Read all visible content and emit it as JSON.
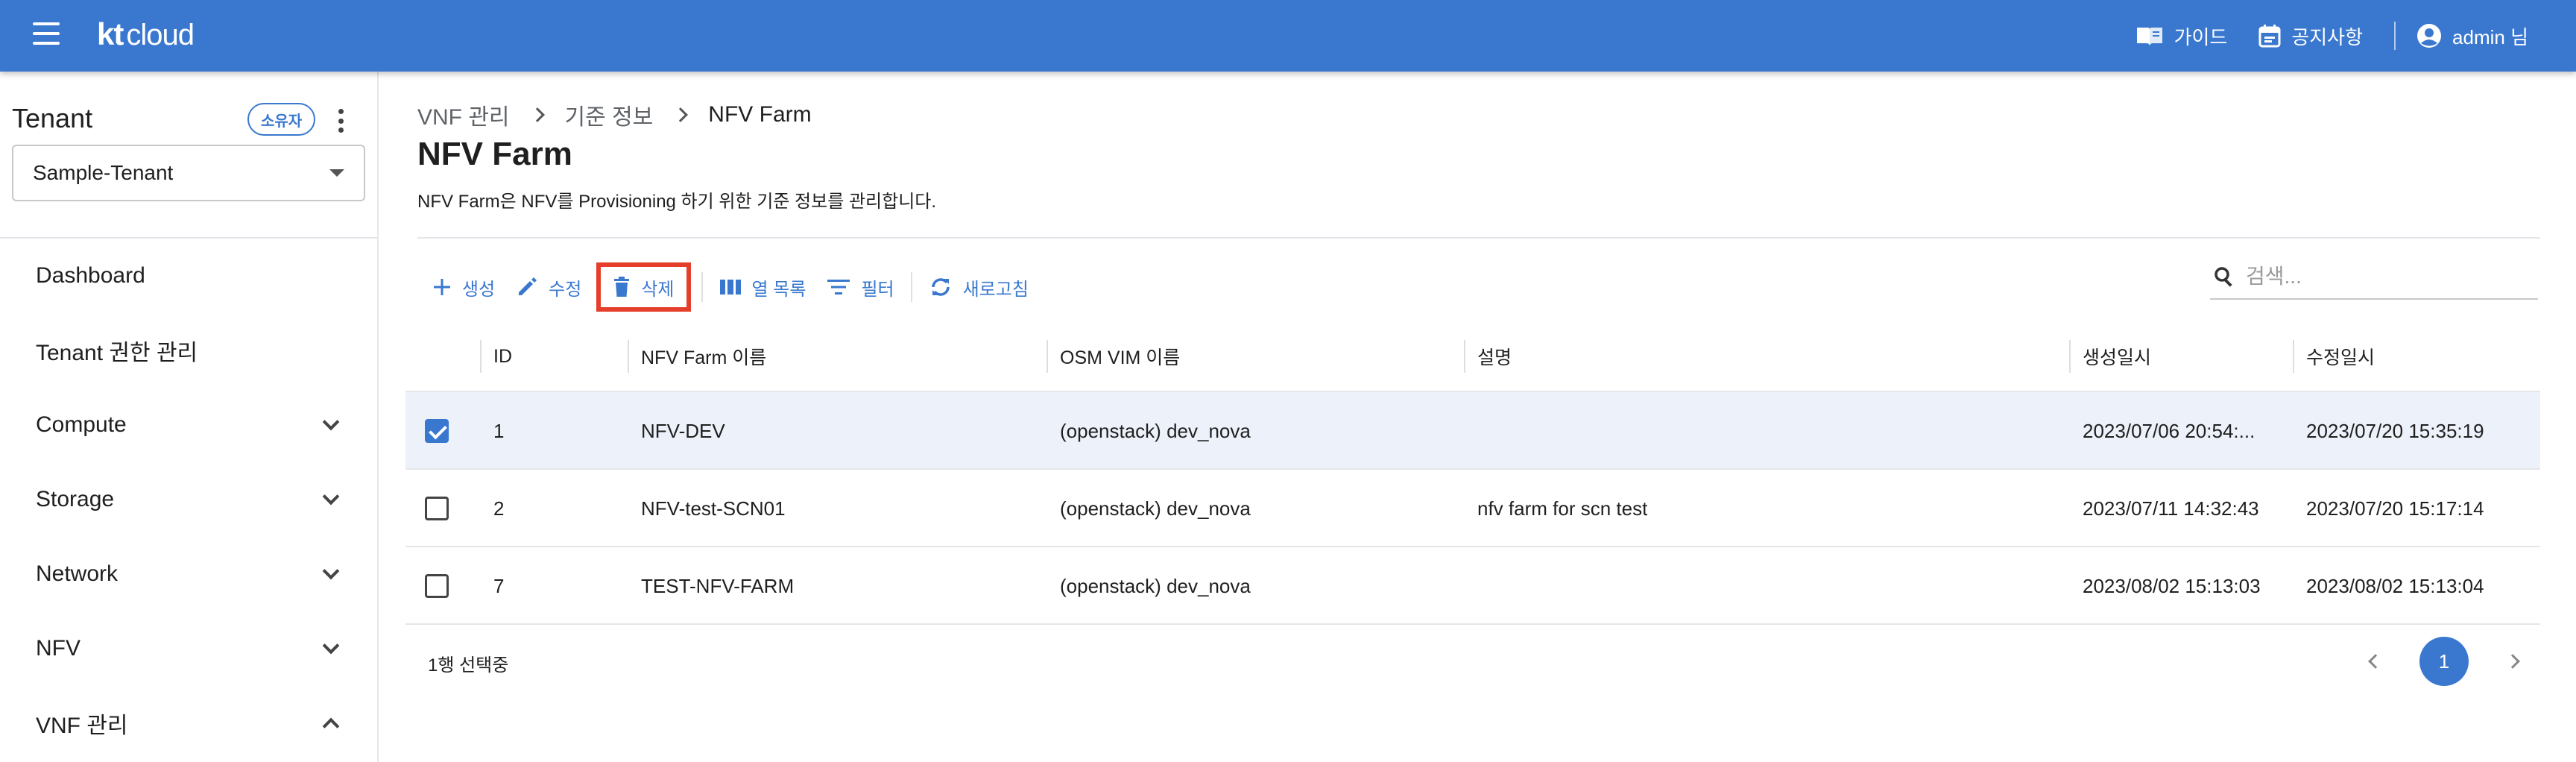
{
  "header": {
    "logo": {
      "kt": "kt",
      "cloud": "cloud"
    },
    "guide": "가이드",
    "notice": "공지사항",
    "user": "admin 님"
  },
  "sidebar": {
    "tenant_label": "Tenant",
    "owner_badge": "소유자",
    "tenant_selected": "Sample-Tenant",
    "items": [
      {
        "label": "Dashboard",
        "expand": ""
      },
      {
        "label": "Tenant 권한 관리",
        "expand": ""
      },
      {
        "label": "Compute",
        "expand": "down"
      },
      {
        "label": "Storage",
        "expand": "down"
      },
      {
        "label": "Network",
        "expand": "down"
      },
      {
        "label": "NFV",
        "expand": "down"
      },
      {
        "label": "VNF 관리",
        "expand": "up"
      }
    ]
  },
  "breadcrumb": [
    "VNF 관리",
    "기준 정보",
    "NFV Farm"
  ],
  "page": {
    "title": "NFV Farm",
    "description": "NFV Farm은 NFV를 Provisioning 하기 위한 기준 정보를 관리합니다."
  },
  "toolbar": {
    "create": "생성",
    "edit": "수정",
    "delete": "삭제",
    "columns": "열 목록",
    "filter": "필터",
    "refresh": "새로고침"
  },
  "search": {
    "placeholder": "검색...",
    "value": ""
  },
  "table": {
    "columns": [
      "ID",
      "NFV Farm 이름",
      "OSM VIM 이름",
      "설명",
      "생성일시",
      "수정일시"
    ],
    "rows": [
      {
        "selected": true,
        "id": "1",
        "name": "NFV-DEV",
        "vim": "(openstack) dev_nova",
        "desc": "",
        "created": "2023/07/06 20:54:...",
        "updated": "2023/07/20 15:35:19"
      },
      {
        "selected": false,
        "id": "2",
        "name": "NFV-test-SCN01",
        "vim": "(openstack) dev_nova",
        "desc": "nfv farm for scn test",
        "created": "2023/07/11 14:32:43",
        "updated": "2023/07/20 15:17:14"
      },
      {
        "selected": false,
        "id": "7",
        "name": "TEST-NFV-FARM",
        "vim": "(openstack) dev_nova",
        "desc": "",
        "created": "2023/08/02 15:13:03",
        "updated": "2023/08/02 15:13:04"
      }
    ]
  },
  "footer": {
    "selection": "1행 선택중",
    "current_page": "1"
  },
  "colors": {
    "primary": "#3a78cf",
    "highlight_box": "#e53e2a",
    "selected_row": "#edf2fa"
  }
}
